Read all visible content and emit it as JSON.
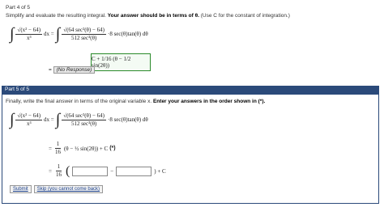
{
  "part4": {
    "heading": "Part 4 of 5",
    "instruction_plain": "Simplify and evaluate the resulting integral.",
    "instruction_bold": "Your answer should be in terms of θ.",
    "instruction_tail": "(Use C for the constant of integration.)",
    "integrand_lhs_num": "√(x² − 64)",
    "integrand_lhs_den": "x³",
    "dx": "dx =",
    "integrand_rhs_num": "√(64 sec²(θ) − 64)",
    "integrand_rhs_den": "512 sec³(θ)",
    "integrand_rhs_tail": "·8 sec(θ)tan(θ) dθ",
    "answer": "C + 1/16 (θ − 1/2 sin(2θ))",
    "response_prefix": "=",
    "response_label": "(No Response)"
  },
  "part5": {
    "heading": "Part 5 of 5",
    "instruction_plain": "Finally, write the final answer in terms of the original variable x.",
    "instruction_bold": "Enter your answers in the order shown in (*).",
    "integrand_lhs_num": "√(x² − 64)",
    "integrand_lhs_den": "x³",
    "dx": "dx =",
    "integrand_rhs_num": "√(64 sec²(θ) − 64)",
    "integrand_rhs_den": "512 sec³(θ)",
    "integrand_rhs_tail": "·8 sec(θ)tan(θ) dθ",
    "step_prefix": "=",
    "step_frac_num": "1",
    "step_frac_den": "16",
    "step_body": "(θ − ½ sin(2θ)) + C",
    "step_star": "(*)",
    "final_prefix": "=",
    "final_frac_num": "1",
    "final_frac_den": "16",
    "final_minus": "−",
    "final_tail": ") + C",
    "input1_value": "",
    "input2_value": "",
    "submit_label": "Submit",
    "skip_label": "Skip (you cannot come back)"
  }
}
